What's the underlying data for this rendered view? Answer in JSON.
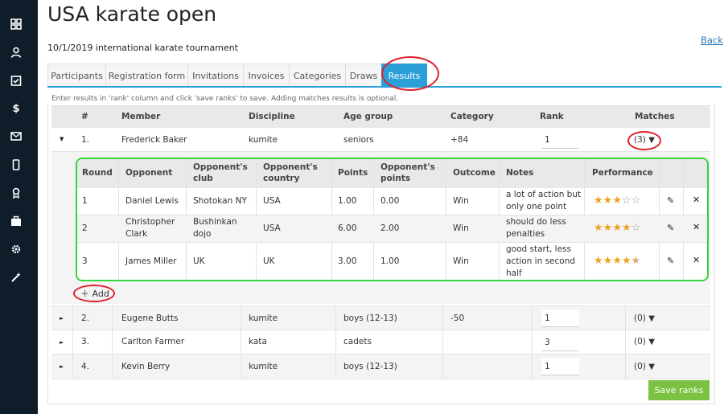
{
  "page": {
    "title": "USA karate open",
    "subtitle": "10/1/2019 international karate tournament",
    "back_label": "Back"
  },
  "sidebar": {
    "icons": [
      "dashboard-icon",
      "user-icon",
      "calendar-check-icon",
      "dollar-icon",
      "mail-icon",
      "mobile-icon",
      "award-icon",
      "briefcase-icon",
      "settings-icon",
      "magic-wand-icon"
    ]
  },
  "tabs": [
    {
      "label": "Participants"
    },
    {
      "label": "Registration form"
    },
    {
      "label": "Invitations"
    },
    {
      "label": "Invoices"
    },
    {
      "label": "Categories"
    },
    {
      "label": "Draws"
    },
    {
      "label": "Results"
    }
  ],
  "active_tab": "Results",
  "hint": "Enter results in 'rank' column and click 'save ranks' to save. Adding matches results is optional.",
  "table": {
    "headers": {
      "num": "#",
      "member": "Member",
      "discipline": "Discipline",
      "age_group": "Age group",
      "category": "Category",
      "rank": "Rank",
      "matches": "Matches"
    },
    "rows": [
      {
        "num": "1.",
        "member": "Frederick Baker",
        "discipline": "kumite",
        "age_group": "seniors",
        "category": "+84",
        "rank": "1",
        "matches": "(3)",
        "caret": "▼"
      },
      {
        "num": "2.",
        "member": "Eugene Butts",
        "discipline": "kumite",
        "age_group": "boys (12-13)",
        "category": "-50",
        "rank": "1",
        "matches": "(0)",
        "caret": "►"
      },
      {
        "num": "3.",
        "member": "Carlton Farmer",
        "discipline": "kata",
        "age_group": "cadets",
        "category": "",
        "rank": "3",
        "matches": "(0)",
        "caret": "►"
      },
      {
        "num": "4.",
        "member": "Kevin Berry",
        "discipline": "kumite",
        "age_group": "boys (12-13)",
        "category": "",
        "rank": "1",
        "matches": "(0)",
        "caret": "►"
      }
    ]
  },
  "matches_table": {
    "headers": {
      "round": "Round",
      "opponent": "Opponent",
      "club_l1": "Opponent's",
      "club_l2": "club",
      "country_l1": "Opponent's",
      "country_l2": "country",
      "points": "Points",
      "opp_points_l1": "Opponent's",
      "opp_points_l2": "points",
      "outcome": "Outcome",
      "notes": "Notes",
      "performance": "Performance"
    },
    "rows": [
      {
        "round": "1",
        "opponent_l1": "Daniel Lewis",
        "opponent_l2": "",
        "club_l1": "Shotokan NY",
        "club_l2": "",
        "country": "USA",
        "points": "1.00",
        "opp_points": "0.00",
        "outcome": "Win",
        "notes_l1": "a lot of action but",
        "notes_l2": "only one point",
        "notes_l3": "",
        "rating": 3
      },
      {
        "round": "2",
        "opponent_l1": "Christopher",
        "opponent_l2": "Clark",
        "club_l1": "Bushinkan",
        "club_l2": "dojo",
        "country": "USA",
        "points": "6.00",
        "opp_points": "2.00",
        "outcome": "Win",
        "notes_l1": "should do less",
        "notes_l2": "penalties",
        "notes_l3": "",
        "rating": 4
      },
      {
        "round": "3",
        "opponent_l1": "James Miller",
        "opponent_l2": "",
        "club_l1": "UK",
        "club_l2": "",
        "country": "UK",
        "points": "3.00",
        "opp_points": "1.00",
        "outcome": "Win",
        "notes_l1": "good start, less",
        "notes_l2": "action in second",
        "notes_l3": "half",
        "rating": 4.5
      }
    ],
    "add_label": "Add"
  },
  "save_label": "Save ranks",
  "colors": {
    "sidebar": "#0f1c2a",
    "accent": "#2a9fd8",
    "save": "#7cc242",
    "highlight_green": "#35d43a",
    "annotation_red": "#e0202a",
    "star": "#f0a020"
  }
}
